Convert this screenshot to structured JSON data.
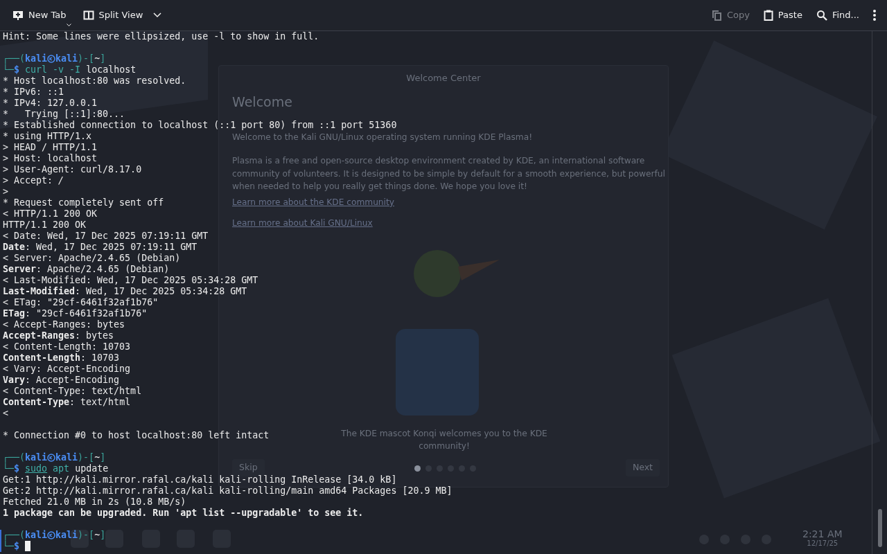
{
  "toolbar": {
    "left": [
      {
        "label": "New Tab",
        "disabled": false
      },
      {
        "label": "Split View",
        "disabled": false
      }
    ],
    "right": [
      {
        "label": "Copy",
        "disabled": true
      },
      {
        "label": "Paste",
        "disabled": false
      },
      {
        "label": "Find...",
        "disabled": false
      }
    ]
  },
  "background_window": {
    "title": "Welcome Center",
    "heading": "Welcome",
    "paragraphs": [
      "Welcome to the Kali GNU/Linux operating system running KDE Plasma!",
      "Plasma is a free and open-source desktop environment created by KDE, an international software community of volunteers. It is designed to be simple by default for a smooth experience, but powerful when needed to help you really get things done. We hope you love it!"
    ],
    "links": [
      "Learn more about the KDE community",
      "Learn more about Kali GNU/Linux"
    ],
    "caption": "The KDE mascot Konqi welcomes you to the KDE community!",
    "skip": "Skip",
    "next": "Next",
    "pages": [
      {
        "selected": true
      },
      {
        "selected": false
      },
      {
        "selected": false
      },
      {
        "selected": false
      },
      {
        "selected": false
      },
      {
        "selected": false
      }
    ]
  },
  "taskbar": {
    "time": "2:21 AM",
    "date": "12/17/25"
  },
  "terminal": [
    {
      "kind": "output",
      "text": "Hint: Some lines were ellipsized, use -l to show in full."
    },
    {
      "kind": "blank"
    },
    {
      "kind": "prompt",
      "open": "┌──(",
      "user": "kali",
      "host": "kali",
      "sep": ")-[",
      "dir": "~",
      "close": "]",
      "corner": "└─",
      "symbol": "$",
      "active": false,
      "command": [
        {
          "text": "curl -v -I",
          "kind": "program"
        },
        {
          "text": "localhost",
          "kind": "arg"
        }
      ]
    },
    {
      "kind": "output",
      "text": "* Host localhost:80 was resolved."
    },
    {
      "kind": "output",
      "text": "* IPv6: ::1"
    },
    {
      "kind": "output",
      "text": "* IPv4: 127.0.0.1"
    },
    {
      "kind": "output",
      "text": "*   Trying [::1]:80..."
    },
    {
      "kind": "output",
      "text": "* Established connection to localhost (::1 port 80) from ::1 port 51360"
    },
    {
      "kind": "output",
      "text": "* using HTTP/1.x"
    },
    {
      "kind": "output",
      "text": "> HEAD / HTTP/1.1"
    },
    {
      "kind": "output",
      "text": "> Host: localhost"
    },
    {
      "kind": "output",
      "text": "> User-Agent: curl/8.17.0"
    },
    {
      "kind": "output",
      "text": "> Accept: */*"
    },
    {
      "kind": "output",
      "text": ">"
    },
    {
      "kind": "output",
      "text": "* Request completely sent off"
    },
    {
      "kind": "output",
      "text": "< HTTP/1.1 200 OK"
    },
    {
      "kind": "output",
      "text": "HTTP/1.1 200 OK"
    },
    {
      "kind": "output",
      "text": "< Date: Wed, 17 Dec 2025 07:19:11 GMT"
    },
    {
      "kind": "output",
      "text": "**Date**: Wed, 17 Dec 2025 07:19:11 GMT"
    },
    {
      "kind": "output",
      "text": "< Server: Apache/2.4.65 (Debian)"
    },
    {
      "kind": "output",
      "text": "**Server**: Apache/2.4.65 (Debian)"
    },
    {
      "kind": "output",
      "text": "< Last-Modified: Wed, 17 Dec 2025 05:34:28 GMT"
    },
    {
      "kind": "output",
      "text": "**Last-Modified**: Wed, 17 Dec 2025 05:34:28 GMT"
    },
    {
      "kind": "output",
      "text": "< ETag: \"29cf-6461f32af1b76\""
    },
    {
      "kind": "output",
      "text": "**ETag**: \"29cf-6461f32af1b76\""
    },
    {
      "kind": "output",
      "text": "< Accept-Ranges: bytes"
    },
    {
      "kind": "output",
      "text": "**Accept-Ranges**: bytes"
    },
    {
      "kind": "output",
      "text": "< Content-Length: 10703"
    },
    {
      "kind": "output",
      "text": "**Content-Length**: 10703"
    },
    {
      "kind": "output",
      "text": "< Vary: Accept-Encoding"
    },
    {
      "kind": "output",
      "text": "**Vary**: Accept-Encoding"
    },
    {
      "kind": "output",
      "text": "< Content-Type: text/html"
    },
    {
      "kind": "output",
      "text": "**Content-Type**: text/html"
    },
    {
      "kind": "output",
      "text": "<"
    },
    {
      "kind": "blank"
    },
    {
      "kind": "output",
      "text": "* Connection #0 to host localhost:80 left intact"
    },
    {
      "kind": "blank"
    },
    {
      "kind": "prompt",
      "open": "┌──(",
      "user": "kali",
      "host": "kali",
      "sep": ")-[",
      "dir": "~",
      "close": "]",
      "corner": "└─",
      "symbol": "$",
      "active": false,
      "command": [
        {
          "text": "sudo",
          "kind": "sudo"
        },
        {
          "text": "apt",
          "kind": "program"
        },
        {
          "text": "update",
          "kind": "arg"
        }
      ]
    },
    {
      "kind": "output",
      "text": "Get:1 http://kali.mirror.rafal.ca/kali kali-rolling InRelease [34.0 kB]"
    },
    {
      "kind": "output",
      "text": "Get:2 http://kali.mirror.rafal.ca/kali kali-rolling/main amd64 Packages [20.9 MB]"
    },
    {
      "kind": "output",
      "text": "Fetched 21.0 MB in 2s (10.8 MB/s)"
    },
    {
      "kind": "bold",
      "text": "1 package can be upgraded. Run 'apt list --upgradable' to see it."
    },
    {
      "kind": "blank"
    },
    {
      "kind": "prompt",
      "open": "┌──(",
      "user": "kali",
      "host": "kali",
      "sep": ")-[",
      "dir": "~",
      "close": "]",
      "corner": "└─",
      "symbol": "$",
      "active": true
    }
  ]
}
